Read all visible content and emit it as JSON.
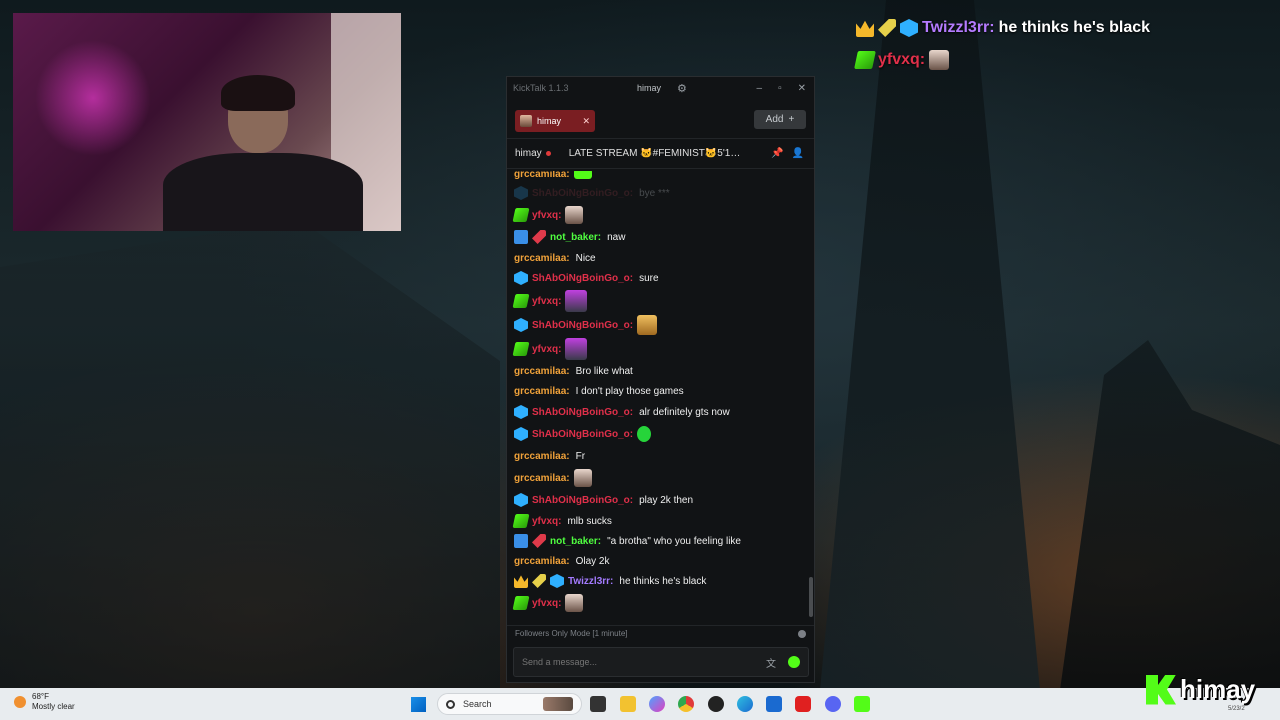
{
  "overlay": {
    "lines": [
      {
        "user": "Twizzl3rr:",
        "text": "he thinks he's black"
      },
      {
        "user": "yfvxq:",
        "text": ""
      }
    ]
  },
  "kicktalk": {
    "app_title": "KickTalk 1.1.3",
    "channel_title": "himay",
    "tab_label": "himay",
    "add_label": "Add",
    "stream_channel": "himay",
    "stream_title": "LATE STREAM 🐱#FEMINIST🐱5'10 ...",
    "messages": [
      {
        "user": "grccamilaa:",
        "text": ""
      },
      {
        "user": "ShAbOiNgBoinGo_o:",
        "text": "bye ***"
      },
      {
        "user": "yfvxq:",
        "text": ""
      },
      {
        "user": "not_baker:",
        "text": "naw"
      },
      {
        "user": "grccamilaa:",
        "text": "Nice"
      },
      {
        "user": "ShAbOiNgBoinGo_o:",
        "text": "sure"
      },
      {
        "user": "yfvxq:",
        "text": ""
      },
      {
        "user": "ShAbOiNgBoinGo_o:",
        "text": ""
      },
      {
        "user": "yfvxq:",
        "text": ""
      },
      {
        "user": "grccamilaa:",
        "text": "Bro like what"
      },
      {
        "user": "grccamilaa:",
        "text": "I don't play those games"
      },
      {
        "user": "ShAbOiNgBoinGo_o:",
        "text": "alr definitely gts now"
      },
      {
        "user": "ShAbOiNgBoinGo_o:",
        "text": ""
      },
      {
        "user": "grccamilaa:",
        "text": "Fr"
      },
      {
        "user": "grccamilaa:",
        "text": ""
      },
      {
        "user": "ShAbOiNgBoinGo_o:",
        "text": "play 2k then"
      },
      {
        "user": "yfvxq:",
        "text": "mlb sucks"
      },
      {
        "user": "not_baker:",
        "text": "\"a brotha\" who you feeling like"
      },
      {
        "user": "grccamilaa:",
        "text": "Olay 2k"
      },
      {
        "user": "Twizzl3rr:",
        "text": "he thinks he's black"
      },
      {
        "user": "yfvxq:",
        "text": ""
      }
    ],
    "followers_mode": "Followers Only Mode [1 minute]",
    "input_placeholder": "Send a message..."
  },
  "taskbar": {
    "temperature": "68°F",
    "weather": "Mostly clear",
    "search_label": "Search",
    "date": "5/23/2"
  },
  "kick_overlay_name": "himay",
  "colors": {
    "kick_green": "#53fc18",
    "tab_red": "#7a1e22",
    "name_orange": "#f0a23a",
    "name_red": "#e0304a",
    "name_green": "#50ff40",
    "name_purple": "#a47bff"
  }
}
